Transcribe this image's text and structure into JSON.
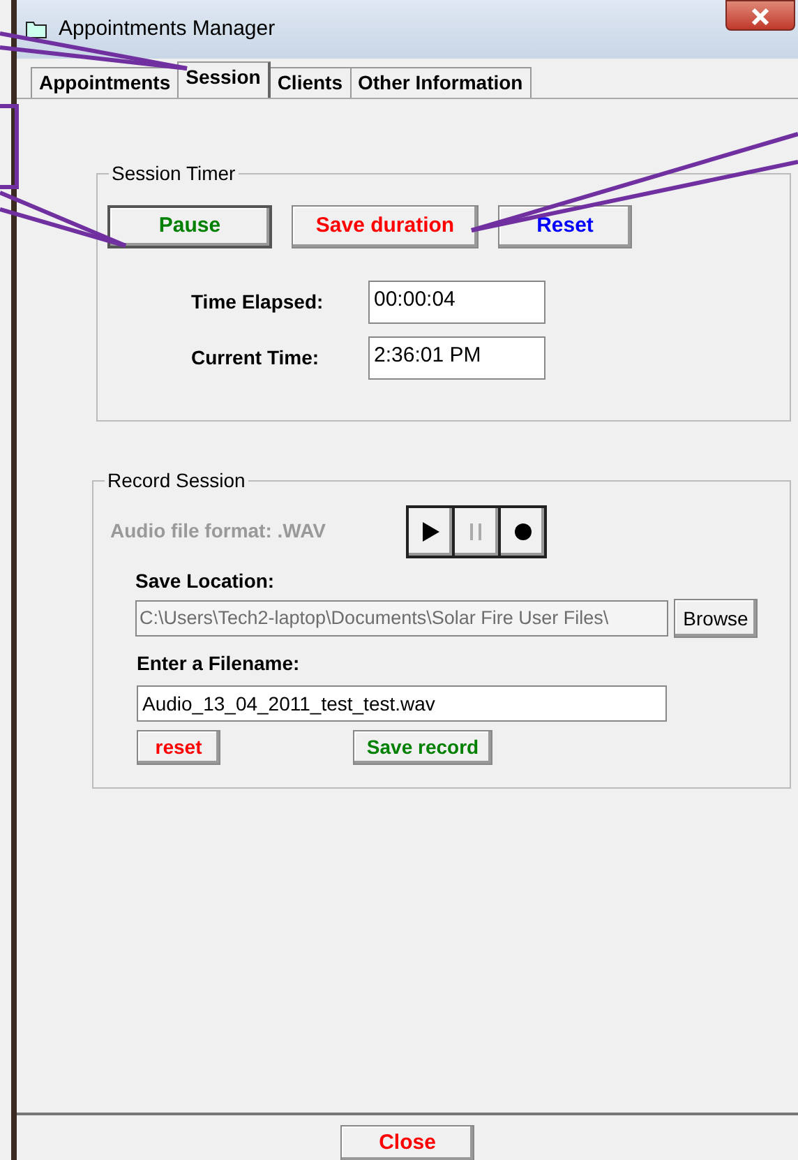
{
  "window": {
    "title": "Appointments Manager"
  },
  "tabs": [
    {
      "label": "Appointments",
      "selected": false
    },
    {
      "label": "Session",
      "selected": true
    },
    {
      "label": "Clients",
      "selected": false
    },
    {
      "label": "Other Information",
      "selected": false
    }
  ],
  "session_timer": {
    "title": "Session Timer",
    "buttons": [
      {
        "label": "Pause",
        "color": "#008000",
        "default": true
      },
      {
        "label": "Save duration",
        "color": "#ff0000",
        "default": false
      },
      {
        "label": "Reset",
        "color": "#0000ff",
        "default": false
      }
    ],
    "fields": [
      {
        "label": "Time Elapsed:",
        "value": "00:00:04"
      },
      {
        "label": "Current Time:",
        "value": "2:36:01 PM"
      }
    ]
  },
  "record_session": {
    "title": "Record Session",
    "format_label": "Audio file format: .WAV",
    "media_buttons": [
      {
        "kind": "play",
        "disabled": false
      },
      {
        "kind": "pause",
        "disabled": true
      },
      {
        "kind": "record",
        "disabled": false
      }
    ],
    "save_location": {
      "label": "Save Location:",
      "value": "C:\\Users\\Tech2-laptop\\Documents\\Solar Fire User Files\\",
      "disabled": true,
      "browse": "Browse"
    },
    "filename": {
      "label": "Enter a Filename:",
      "value": "Audio_13_04_2011_test_test.wav"
    },
    "buttons": [
      {
        "label": "reset",
        "color": "#ff0000"
      },
      {
        "label": "Save record",
        "color": "#008000"
      }
    ]
  },
  "close_button": {
    "label": "Close",
    "color": "#ff0000"
  }
}
